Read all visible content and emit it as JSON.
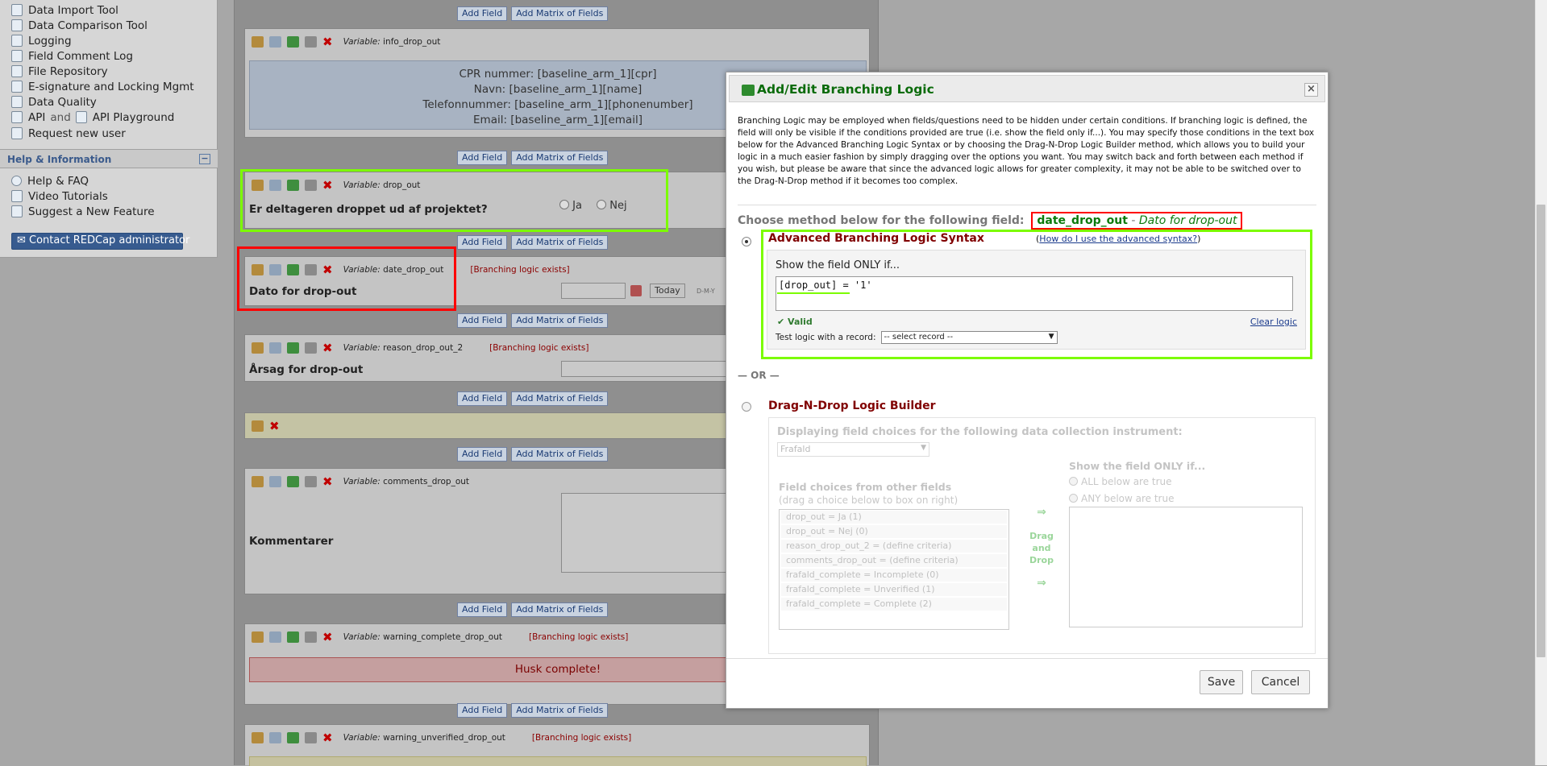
{
  "sidebar": {
    "items": [
      "Data Import Tool",
      "Data Comparison Tool",
      "Logging",
      "Field Comment Log",
      "File Repository",
      "E-signature and Locking Mgmt",
      "Data Quality",
      "API",
      "and",
      "API Playground",
      "Request new user"
    ],
    "help_header": "Help & Information",
    "help_items": [
      "Help & FAQ",
      "Video Tutorials",
      "Suggest a New Feature"
    ],
    "contact_button": "✉ Contact REDCap administrator"
  },
  "main": {
    "add_field": "Add Field",
    "add_matrix": "Add Matrix of Fields",
    "variable_prefix": "Variable:",
    "branching_exists": "[Branching logic exists]",
    "info_drop_out": {
      "variable": "info_drop_out",
      "lines": [
        "CPR nummer: [baseline_arm_1][cpr]",
        "Navn: [baseline_arm_1][name]",
        "Telefonnummer: [baseline_arm_1][phonenumber]",
        "Email: [baseline_arm_1][email]"
      ]
    },
    "drop_out": {
      "variable": "drop_out",
      "label": "Er deltageren droppet ud af projektet?",
      "opt_yes": "Ja",
      "opt_no": "Nej"
    },
    "date_drop_out": {
      "variable": "date_drop_out",
      "label": "Dato for drop-out",
      "today": "Today",
      "format": "D-M-Y"
    },
    "reason_drop_out_2": {
      "variable": "reason_drop_out_2",
      "label": "Årsag for drop-out"
    },
    "comments_drop_out": {
      "variable": "comments_drop_out",
      "label": "Kommentarer"
    },
    "warning_complete_drop_out": {
      "variable": "warning_complete_drop_out",
      "text": "Husk complete!"
    },
    "warning_unverified_drop_out": {
      "variable": "warning_unverified_drop_out"
    }
  },
  "dialog": {
    "title": "Add/Edit Branching Logic",
    "close": "×",
    "intro": "Branching Logic may be employed when fields/questions need to be hidden under certain conditions. If branching logic is defined, the field will only be visible if the conditions provided are true (i.e. show the field only if...). You may specify those conditions in the text box below for the Advanced Branching Logic Syntax or by choosing the Drag-N-Drop Logic Builder method, which allows you to build your logic in a much easier fashion by simply dragging over the options you want. You may switch back and forth between each method if you wish, but please be aware that since the advanced logic allows for greater complexity, it may not be able to be switched over to the Drag-N-Drop method if it becomes too complex.",
    "choose_label": "Choose method below for the following field:",
    "field_name": "date_drop_out",
    "field_sep": " - ",
    "field_label": "Dato for drop-out",
    "advanced": {
      "title": "Advanced Branching Logic Syntax",
      "help_prefix": "(",
      "help_link": "How do I use the advanced syntax?",
      "help_suffix": ")",
      "show_only": "Show the field ONLY if...",
      "logic": "[drop_out] = '1'",
      "valid": "✔ Valid",
      "clear": "Clear logic",
      "test_label": "Test logic with a record:",
      "test_select": "-- select record --"
    },
    "or": "— OR —",
    "dnd": {
      "title": "Drag-N-Drop Logic Builder",
      "instrument_label": "Displaying field choices for the following data collection instrument:",
      "instrument": "Frafald",
      "choices_title": "Field choices from other fields",
      "choices_sub": "(drag a choice below to box on right)",
      "choices": [
        "drop_out = Ja (1)",
        "drop_out = Nej (0)",
        "reason_drop_out_2 = (define criteria)",
        "comments_drop_out = (define criteria)",
        "frafald_complete = Incomplete (0)",
        "frafald_complete = Unverified (1)",
        "frafald_complete = Complete (2)"
      ],
      "arrow": "⇒",
      "drag": "Drag",
      "and": "and",
      "drop": "Drop",
      "show_only": "Show the field ONLY if...",
      "all_true": "ALL below are true",
      "any_true": "ANY below are true"
    },
    "save": "Save",
    "cancel": "Cancel"
  }
}
